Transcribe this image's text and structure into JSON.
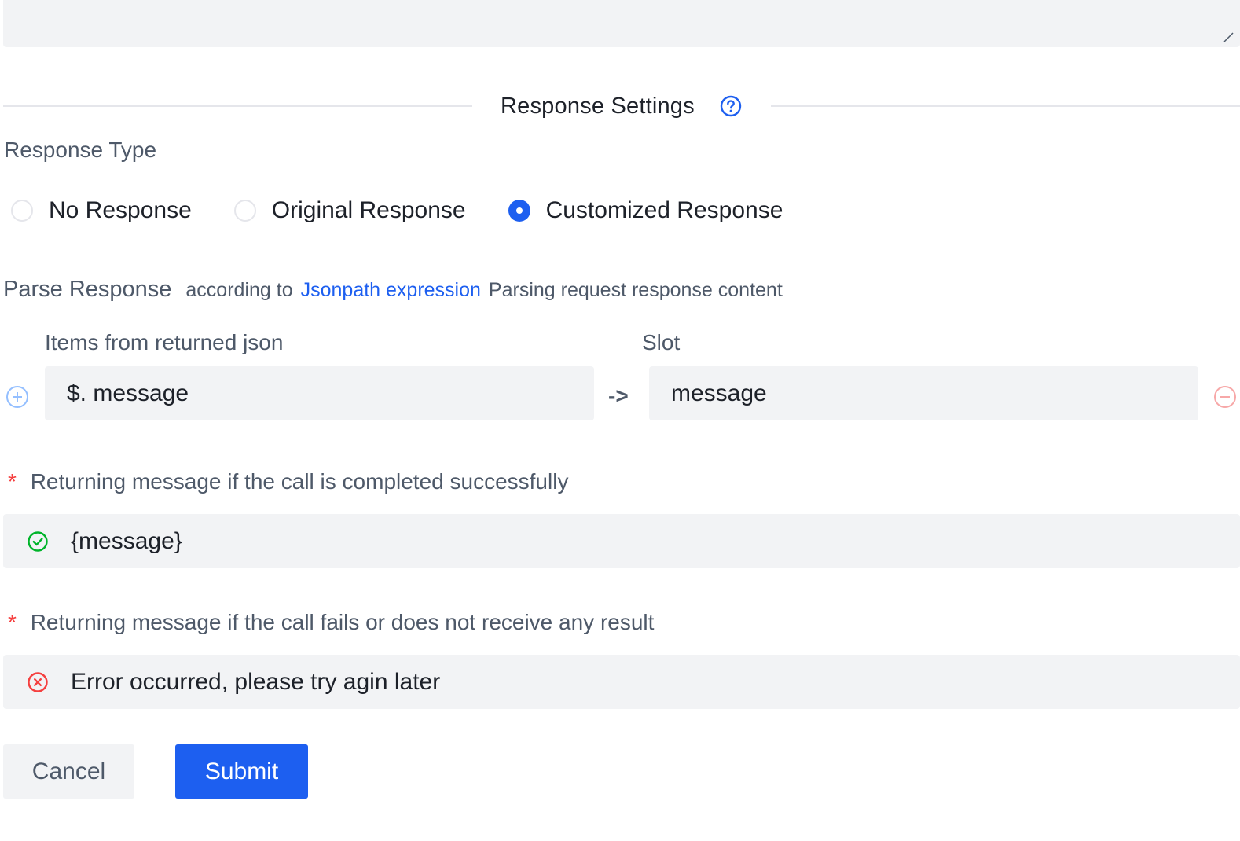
{
  "section": {
    "title": "Response Settings"
  },
  "response_type": {
    "label": "Response Type",
    "options": [
      {
        "label": "No Response",
        "checked": false
      },
      {
        "label": "Original Response",
        "checked": false
      },
      {
        "label": "Customized Response",
        "checked": true
      }
    ]
  },
  "parse_response": {
    "title": "Parse Response",
    "hint_prefix": "according to",
    "link_text": "Jsonpath expression",
    "hint_suffix": "Parsing request response content",
    "items_label": "Items from returned json",
    "slot_label": "Slot",
    "arrow": "->",
    "rows": [
      {
        "json_path": "$. message",
        "slot": "message"
      }
    ]
  },
  "success_message": {
    "required_mark": "*",
    "label": "Returning message if the call is completed successfully",
    "value": "{message}"
  },
  "failure_message": {
    "required_mark": "*",
    "label": "Returning message if the call fails or does not receive any result",
    "value": "Error occurred, please try agin later"
  },
  "buttons": {
    "cancel": "Cancel",
    "submit": "Submit"
  },
  "colors": {
    "primary": "#1d5ff0",
    "success": "#00b42a",
    "danger": "#f53f3f",
    "input_bg": "#f2f3f5"
  }
}
